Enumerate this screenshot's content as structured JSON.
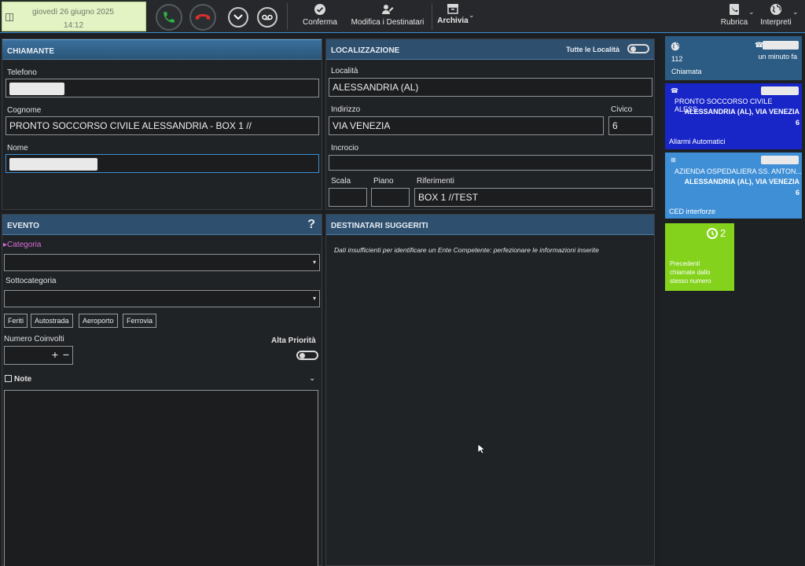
{
  "toolbar": {
    "date": "giovedì 26 giugno 2025",
    "time": "14:12",
    "conferma": "Conferma",
    "modifica": "Modifica i Destinatari",
    "archivia": "Archivia",
    "rubrica": "Rubrica",
    "interpreti": "Interpreti"
  },
  "chiamante": {
    "title": "CHIAMANTE",
    "telefono_label": "Telefono",
    "cognome_label": "Cognome",
    "cognome_value": "PRONTO SOCCORSO CIVILE ALESSANDRIA - BOX 1 //",
    "nome_label": "Nome"
  },
  "localizzazione": {
    "title": "LOCALIZZAZIONE",
    "tutte_label": "Tutte le Località",
    "localita_label": "Località",
    "localita_value": "ALESSANDRIA (AL)",
    "indirizzo_label": "Indirizzo",
    "indirizzo_value": "VIA VENEZIA",
    "civico_label": "Civico",
    "civico_value": "6",
    "incrocio_label": "Incrocio",
    "scala_label": "Scala",
    "piano_label": "Piano",
    "riferimenti_label": "Riferimenti",
    "riferimenti_value": "BOX 1 //TEST"
  },
  "evento": {
    "title": "EVENTO",
    "help": "?",
    "categoria_label": "Categoria",
    "sottocategoria_label": "Sottocategoria",
    "tags": [
      "Feriti",
      "Autostrada",
      "Aeroporto",
      "Ferrovia"
    ],
    "numero_label": "Numero Coinvolti",
    "plus": "+",
    "minus": "−",
    "alta_priorita_label": "Alta Priorità",
    "note_label": "Note"
  },
  "destinatari": {
    "title": "DESTINATARI SUGGERITI",
    "message": "Dati insufficienti per identificare un Ente Competente: perfezionare le informazioni inserite"
  },
  "cards": {
    "call": {
      "number": "112",
      "time": "un minuto fa",
      "label": "Chiamata"
    },
    "allarmi": {
      "title": "PRONTO SOCCORSO CIVILE ALESS...",
      "address": "ALESSANDRIA (AL), VIA VENEZIA",
      "civico": "6",
      "footer": "Allarmi Automatici"
    },
    "ced": {
      "title": "AZIENDA OSPEDALIERA SS. ANTON...",
      "address": "ALESSANDRIA (AL), VIA VENEZIA",
      "civico": "6",
      "footer": "CED interforze"
    },
    "precedenti": {
      "count": "2",
      "line1": "Precedenti",
      "line2": "chiamate dallo",
      "line3": "stesso numero"
    }
  },
  "colors": {
    "accent": "#3c8fd0",
    "allarmi_card": "#1826c8",
    "ced_card": "#3f8fd6",
    "precedenti_card": "#84d21c",
    "date_bg": "#e3f3c4"
  }
}
